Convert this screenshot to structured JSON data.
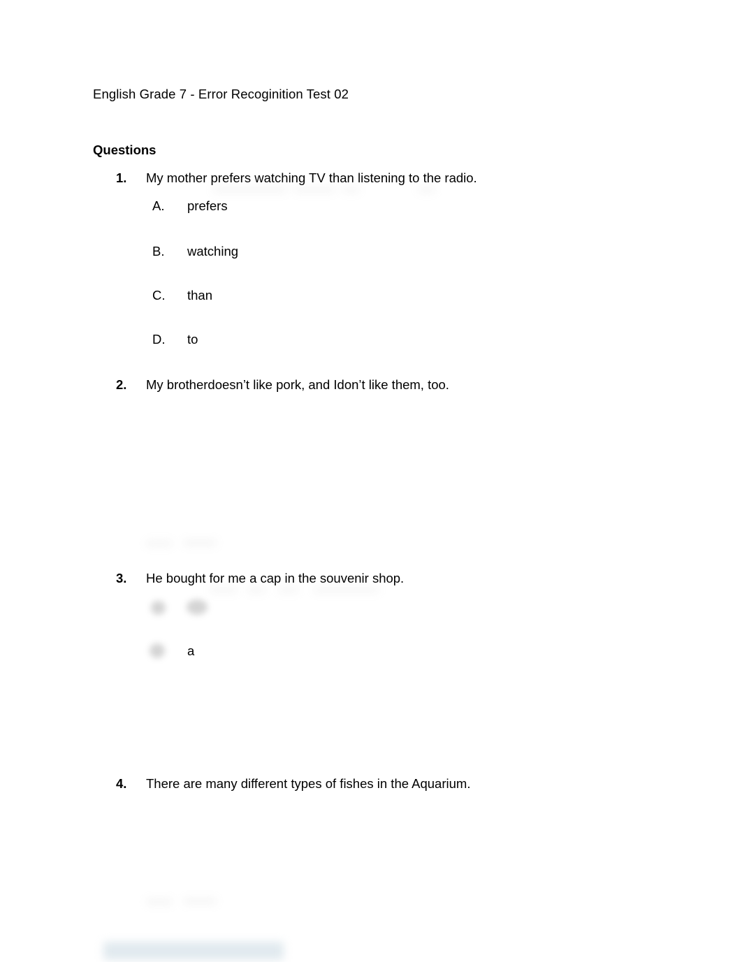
{
  "document": {
    "title": "English Grade 7 - Error Recoginition Test 02",
    "section_heading": "Questions",
    "background_color": "#ffffff",
    "text_color": "#000000"
  },
  "questions": [
    {
      "number": "1.",
      "text": "My mother prefers watching TV than listening to the radio.",
      "options": [
        {
          "letter": "A.",
          "text": "prefers"
        },
        {
          "letter": "B.",
          "text": "watching"
        },
        {
          "letter": "C.",
          "text": "than"
        },
        {
          "letter": "D.",
          "text": "to"
        }
      ]
    },
    {
      "number": "2.",
      "text": "My brotherdoesn’t like pork, and Idon’t like them, too.",
      "options": []
    },
    {
      "number": "3.",
      "text": "He bought for me a cap in the souvenir shop.",
      "options": [
        {
          "letter": "",
          "text": ""
        },
        {
          "letter": "",
          "text": "a"
        }
      ]
    },
    {
      "number": "4.",
      "text": "There are many different types of fishes in the Aquarium.",
      "options": []
    }
  ],
  "artifacts": {
    "description": "blurred redaction marks",
    "blur_color": "#b9b9b9",
    "bottom_bar_color": "#dce6ec"
  }
}
